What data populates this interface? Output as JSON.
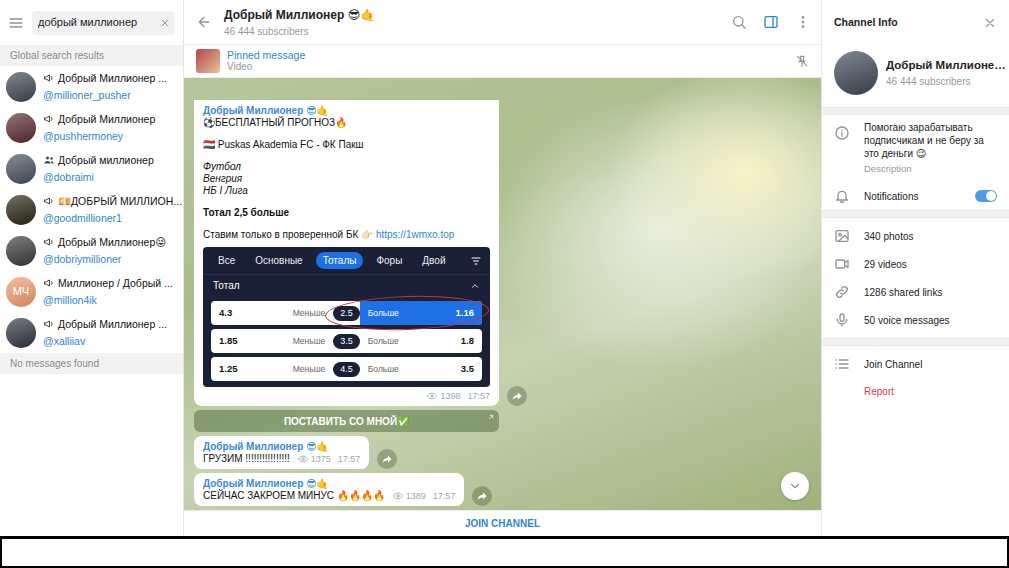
{
  "left_panel": {
    "search": {
      "value": "добрый миллионер"
    },
    "results_header": "Global search results",
    "results": [
      {
        "kind": "channel",
        "name": "Добрый Миллионер ...",
        "username": "@millioner_pusher",
        "avatar": {
          "kind": "photo",
          "text": "",
          "color": "#3d4756"
        }
      },
      {
        "kind": "channel",
        "name": "Добрый Миллионер",
        "username": "@pushhermoney",
        "avatar": {
          "kind": "photo",
          "text": "",
          "color": "#5a2a30"
        }
      },
      {
        "kind": "group",
        "name": "Добрый миллионер",
        "username": "@dobraimi",
        "avatar": {
          "kind": "photo",
          "text": "",
          "color": "#45505e"
        }
      },
      {
        "kind": "channel",
        "name": "💴ДОБРЫЙ МИЛЛИОН...",
        "username": "@goodmillioner1",
        "avatar": {
          "kind": "photo",
          "text": "",
          "color": "#2a2614"
        }
      },
      {
        "kind": "channel",
        "name": "Добрый Миллионер😜",
        "username": "@dobriymillioner",
        "avatar": {
          "kind": "photo",
          "text": "",
          "color": "#3a3a3a"
        }
      },
      {
        "kind": "channel",
        "name": "Миллионер / Добрый ...",
        "username": "@million4ik",
        "avatar": {
          "kind": "initials",
          "text": "МЧ",
          "color": "#f39c6b"
        }
      },
      {
        "kind": "channel",
        "name": "Добрый Миллионер ...",
        "username": "@xalliiav",
        "avatar": {
          "kind": "photo",
          "text": "",
          "color": "#2f3540"
        }
      }
    ],
    "empty_note": "No messages found"
  },
  "chat": {
    "title": "Добрый Миллионер 😎🤙",
    "subtitle": "46 444 subscribers",
    "info_panel_open": true,
    "pinned": {
      "label": "Pinned message",
      "type": "Video"
    },
    "messages": [
      {
        "kind": "post",
        "author": "Добрый Миллионер 😎🤙",
        "lines": [
          [
            {
              "text": "⚽️БЕСПЛАТНЫЙ ПРОГНОЗ🔥",
              "style": "normal"
            }
          ],
          [],
          [
            {
              "text": "🇭🇺 Puskas Akademia FC - ФК Пакш",
              "style": "normal"
            }
          ],
          [],
          [
            {
              "text": "Футбол",
              "style": "italic"
            }
          ],
          [
            {
              "text": "Венгрия",
              "style": "italic"
            }
          ],
          [
            {
              "text": "НБ I Лига",
              "style": "italic"
            }
          ],
          [],
          [
            {
              "text": "Тотал 2,5 больше",
              "style": "bold"
            }
          ],
          [],
          [
            {
              "text": "Ставим только в проверенной БК 👉🏻 ",
              "style": "normal"
            },
            {
              "text": "https://1wmxo.top",
              "style": "link"
            }
          ]
        ],
        "widget": {
          "tabs": [
            {
              "label": "Все",
              "selected": false
            },
            {
              "label": "Основные",
              "selected": false
            },
            {
              "label": "Тоталы",
              "selected": true
            },
            {
              "label": "Форы",
              "selected": false
            },
            {
              "label": "Двой",
              "selected": false
            }
          ],
          "section": "Тотал",
          "expanded": true,
          "rows": [
            {
              "under_odds": "4.3",
              "under": "Меньше",
              "line": "2.5",
              "over": "Больше",
              "over_odds": "1.16",
              "selected": true,
              "circled": true
            },
            {
              "under_odds": "1.85",
              "under": "Меньше",
              "line": "3.5",
              "over": "Больше",
              "over_odds": "1.8",
              "selected": false,
              "circled": false
            },
            {
              "under_odds": "1.25",
              "under": "Меньше",
              "line": "4.5",
              "over": "Больше",
              "over_odds": "3.5",
              "selected": false,
              "circled": false
            }
          ]
        },
        "views": "1398",
        "time": "17:57",
        "button": {
          "label": "ПОСТАВИТЬ СО МНОЙ✅"
        }
      },
      {
        "kind": "text",
        "author": "Добрый Миллионер 😎🤙",
        "lines": [
          [
            {
              "text": "ГРУЗИМ !!!!!!!!!!!!!!!!",
              "style": "normal"
            }
          ]
        ],
        "views": "1375",
        "time": "17:57"
      },
      {
        "kind": "text",
        "author": "Добрый Миллионер 😎🤙",
        "lines": [
          [
            {
              "text": "СЕЙЧАС ЗАКРОЕМ МИНУС 🔥🔥🔥🔥",
              "style": "normal"
            }
          ]
        ],
        "views": "1389",
        "time": "17:57"
      }
    ],
    "join_label": "JOIN CHANNEL"
  },
  "info_panel": {
    "title": "Channel Info",
    "avatar_color": "#3d4756",
    "name": "Добрый Миллионе…",
    "subscribers": "46 444 subscribers",
    "description": "Помогаю зарабатывать подписчикам и не беру за это деньги 😉",
    "description_label": "Description",
    "notifications": {
      "label": "Notifications",
      "on": true
    },
    "media": [
      {
        "label": "340 photos"
      },
      {
        "label": "29 videos"
      },
      {
        "label": "1286 shared links"
      },
      {
        "label": "50 voice messages"
      }
    ],
    "actions": [
      {
        "kind": "action",
        "label": "Join Channel"
      },
      {
        "kind": "danger",
        "label": "Report"
      }
    ]
  }
}
